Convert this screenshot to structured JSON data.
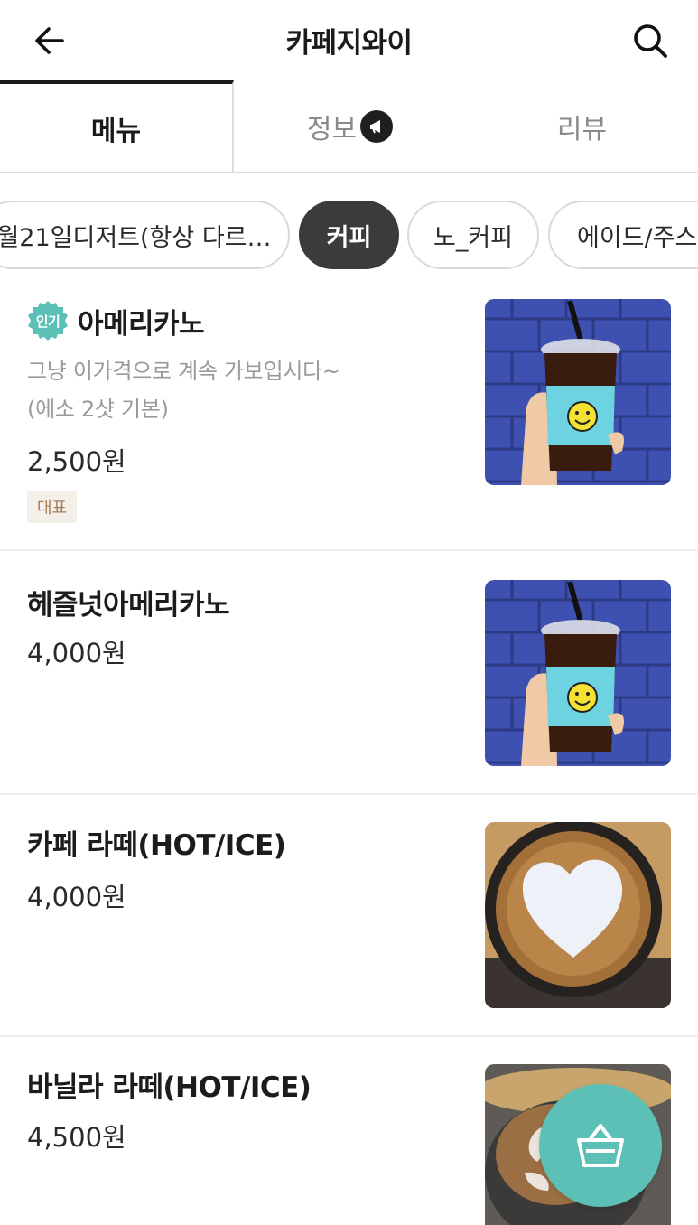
{
  "header": {
    "title": "카페지와이",
    "back_icon": "arrow-left-icon",
    "search_icon": "search-icon"
  },
  "tabs": [
    {
      "label": "메뉴",
      "active": true
    },
    {
      "label": "정보",
      "active": false,
      "icon": "megaphone-icon"
    },
    {
      "label": "리뷰",
      "active": false
    }
  ],
  "categories": [
    {
      "label": "월21일디저트(항상 다르…",
      "active": false
    },
    {
      "label": "커피",
      "active": true
    },
    {
      "label": "노_커피",
      "active": false
    },
    {
      "label": "에이드/주스",
      "active": false
    }
  ],
  "menu": [
    {
      "badge": "인기",
      "name": "아메리카노",
      "desc": [
        "그냥 이가격으로 계속 가보입시다~",
        "(에소 2샷 기본)"
      ],
      "price": "2,500원",
      "tag": "대표",
      "image": "iced-coffee-photo"
    },
    {
      "name": "헤즐넛아메리카노",
      "price": "4,000원",
      "image": "iced-coffee-photo"
    },
    {
      "name": "카페 라떼(HOT/ICE)",
      "price": "4,000원",
      "image": "latte-art-photo"
    },
    {
      "name": "바닐라 라떼(HOT/ICE)",
      "price": "4,500원",
      "image": "latte-photo"
    }
  ],
  "cart": {
    "icon": "basket-icon"
  },
  "colors": {
    "accent": "#5cc0b7",
    "active_chip": "#3b3b3b",
    "tag_bg": "#f4efe9",
    "tag_text": "#a77d55"
  }
}
